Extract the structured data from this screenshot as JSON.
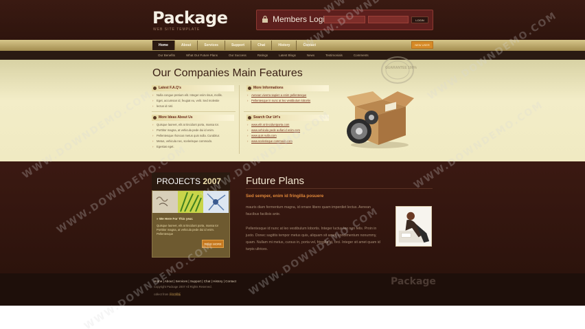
{
  "site": {
    "logo": "Package",
    "logo_tagline": "WEB SITE TEMPLATE"
  },
  "login": {
    "title": "Members Login:",
    "username_placeholder": "",
    "password_placeholder": "",
    "button": "LOGIN"
  },
  "nav": {
    "items": [
      "Home",
      "About",
      "Services",
      "Support",
      "Chat",
      "History",
      "Contact"
    ],
    "active_index": 0,
    "right_button": "NEW USER"
  },
  "subnav": {
    "items": [
      "Our Benefits",
      "What Our Future Plans",
      "Our Success",
      "Ratings",
      "Latest Blogs",
      "News",
      "Testimonials",
      "Comments"
    ]
  },
  "features": {
    "title": "Our Companies Main Features",
    "faq": {
      "heading": "Latest F.A.Q's",
      "items": [
        "Nulla congue pretium elit. Integer enim risus, mollis.",
        "Eget, accumsan id, feugiat eu, velit. Sed molestie",
        "lectus id nisl."
      ]
    },
    "info": {
      "heading": "More Informations",
      "items": [
        "Aenean viverra sapien a enim pellentesque",
        "Pellentesque in nunc at leo vestibulum lobortis"
      ]
    },
    "more_ideas": {
      "heading": "More Ideas About Us",
      "items": [
        "Quisque laoreet, elit at tincidunt porta, massa tor.",
        "Porttitor magna, at vehicula pede dui id enim.",
        "Pellentesque rhoncus metus quis nulla. Curabitur.",
        "Metus, vehicula nec, scelerisque commodo.",
        "Egestas eget."
      ]
    },
    "urls": {
      "heading": "Search Our Url's",
      "items": [
        "www.elit at tinciduntporta.com",
        "www.vehicula pede aufiat id enim.com",
        "www.quis nulla.com",
        "www.scelerisque commodo.com"
      ]
    },
    "stamp": "GUARANTEE 100%"
  },
  "projects": {
    "title_plain": "PROJECTS",
    "title_year": "2007",
    "subheading": "We Here For This year.",
    "text": "Quisque laoreet, elit at tincidunt porta, massa tor Porttitor magna, at vehicula pede dui id enim. Pellentesque",
    "button": "READ MORE"
  },
  "future_plans": {
    "title": "Future Plans",
    "subtitle": "Sed semper, enim id fringilla posuere",
    "para1": "mauris diam fermentum magna, id ornare libero quam imperdiet lectus. Aenean faucibus facilisis ante.",
    "para2": "Pellentesque id nunc at leo vestibulum lobortis. Integer luctus leo non felis. Proin in justo. Donec sagittis tempor metus quis, aliquam sit amet, condimentum nonummy, quam. Nullam mi metus, cursus in, porta vel, fringilla et, orci. Integer sit amet quam id turpis ultrices."
  },
  "footer": {
    "links": "Home | About | Services | Support | Chat | History | Contact",
    "copyright": "Copyright Package 2007 All Rights Reserved.",
    "credit_label": "collect from",
    "credit_value": "网站模板",
    "logo": "Package"
  },
  "watermark": "WWW.DOWNDEMO.COM",
  "colors": {
    "header_bg": "#3a1a12",
    "nav_gold": "#c8b678",
    "cream": "#f3edc8",
    "accent_orange": "#e2893a",
    "footer_bg": "#1e0f0a"
  }
}
